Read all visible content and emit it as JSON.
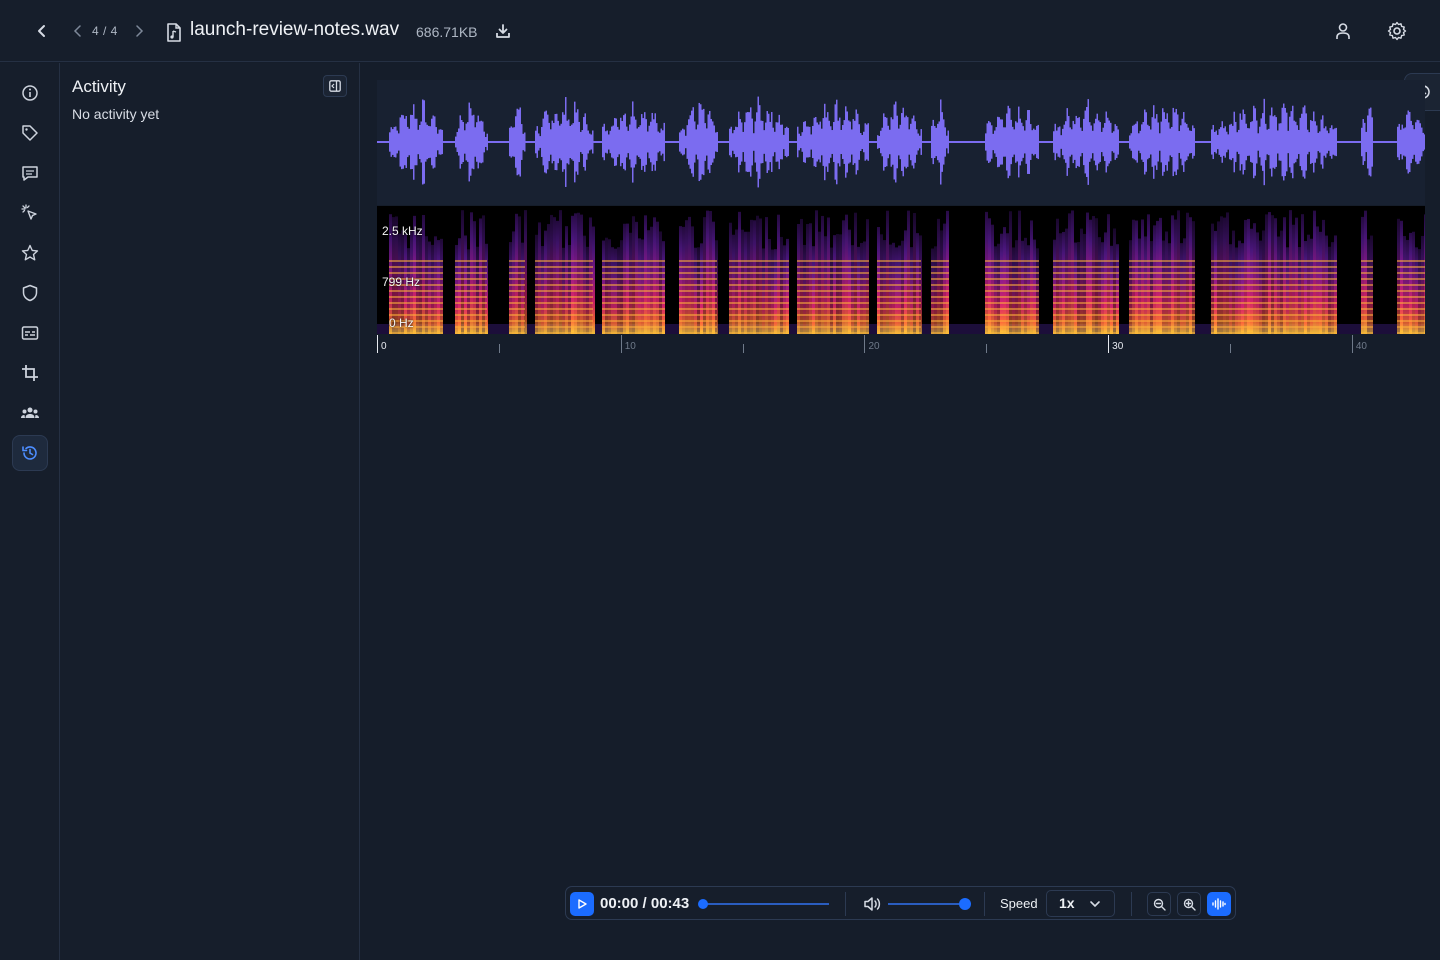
{
  "header": {
    "pager": "4 / 4",
    "file_name": "launch-review-notes.wav",
    "file_size": "686.71KB"
  },
  "icons": {
    "back": "chevron-left-icon",
    "prev": "chevron-left-icon",
    "next": "chevron-right-icon",
    "file": "audio-file-icon",
    "download": "download-icon",
    "user": "user-icon",
    "settings": "gear-icon"
  },
  "rail": {
    "items": [
      {
        "name": "info-icon"
      },
      {
        "name": "tag-icon"
      },
      {
        "name": "comment-icon"
      },
      {
        "name": "sparkle-cursor-icon"
      },
      {
        "name": "star-icon"
      },
      {
        "name": "shield-icon"
      },
      {
        "name": "subtitles-icon"
      },
      {
        "name": "crop-icon"
      },
      {
        "name": "team-icon"
      },
      {
        "name": "history-icon",
        "active": true
      }
    ]
  },
  "panel": {
    "title": "Activity",
    "empty_text": "No activity yet"
  },
  "spectrogram": {
    "labels": [
      "2.5 kHz",
      "799 Hz",
      "0   Hz"
    ]
  },
  "timeline": {
    "labels": [
      "0",
      "10",
      "20",
      "30",
      "40"
    ],
    "duration_seconds": 43
  },
  "player": {
    "time": "00:00 / 00:43",
    "progress": 0,
    "volume": 1.0,
    "speed_label": "Speed",
    "speed_value": "1x"
  },
  "colors": {
    "accent": "#1b6cff",
    "waveform": "#7b6cf0"
  }
}
